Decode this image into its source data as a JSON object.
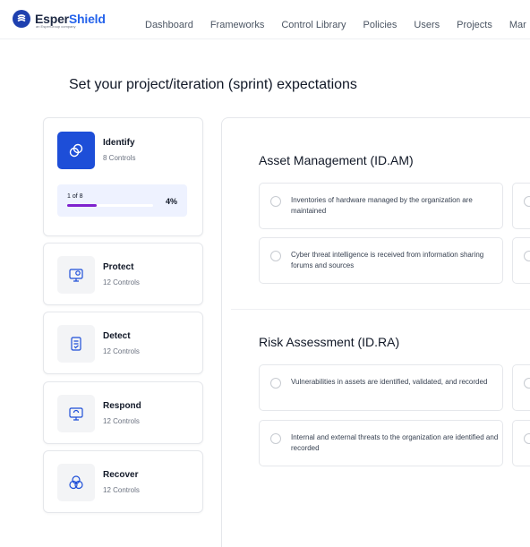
{
  "app": {
    "logo_name_a": "Esper",
    "logo_name_b": "Shield",
    "logo_sub": "an EsperGroup company"
  },
  "nav": {
    "items": [
      "Dashboard",
      "Frameworks",
      "Control Library",
      "Policies",
      "Users",
      "Projects",
      "Mar"
    ]
  },
  "page": {
    "title": "Set your project/iteration (sprint) expectations"
  },
  "categories": [
    {
      "name": "Identify",
      "count": "8 Controls",
      "icon": "identify-icon",
      "active": true,
      "progress_label": "1 of 8",
      "progress_percent": "4%",
      "progress_fraction": 0.04
    },
    {
      "name": "Protect",
      "count": "12 Controls",
      "icon": "protect-icon"
    },
    {
      "name": "Detect",
      "count": "12 Controls",
      "icon": "detect-icon"
    },
    {
      "name": "Respond",
      "count": "12 Controls",
      "icon": "respond-icon"
    },
    {
      "name": "Recover",
      "count": "12 Controls",
      "icon": "recover-icon"
    }
  ],
  "sections": [
    {
      "title": "Asset Management (ID.AM)",
      "options": [
        " Inventories of hardware managed by the organization are maintained",
        " Cyber threat intelligence is received from information sharing forums and sources"
      ]
    },
    {
      "title": "Risk Assessment (ID.RA)",
      "options": [
        "Vulnerabilities in assets are identified, validated, and recorded",
        " Internal and external threats to the organization are identified and recorded"
      ]
    }
  ],
  "colors": {
    "accent": "#1d4ed8",
    "progress": "#7e22ce",
    "progress_bg": "#eef2ff"
  }
}
